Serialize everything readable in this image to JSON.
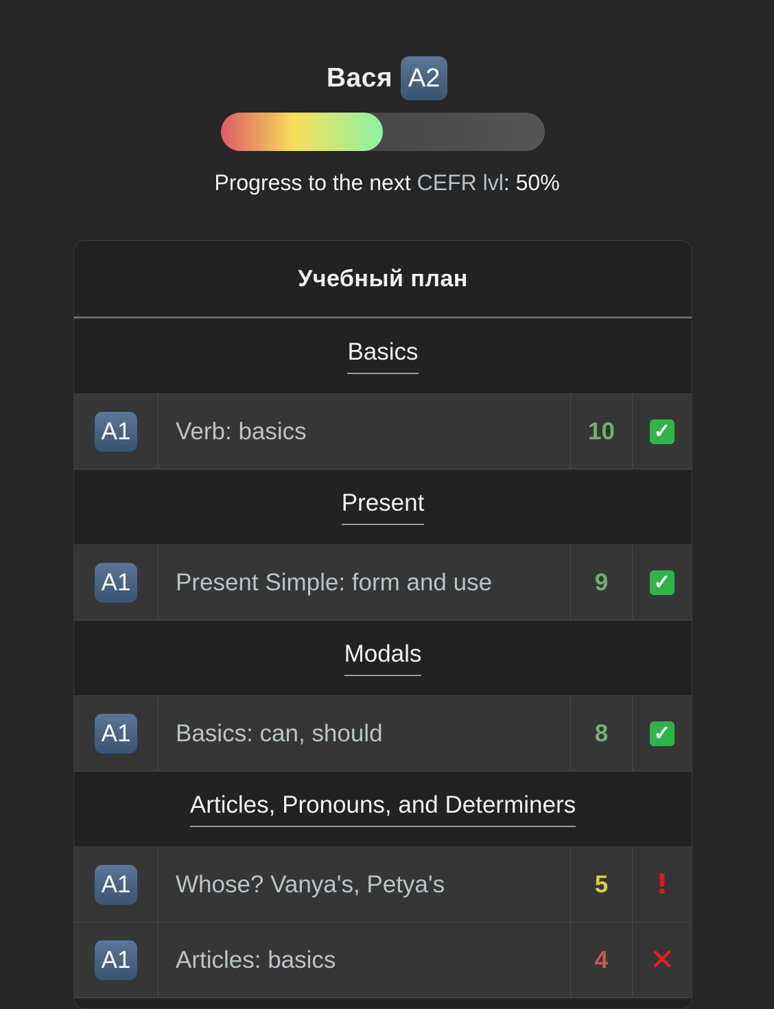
{
  "user": {
    "name": "Вася",
    "level": "A2"
  },
  "progress": {
    "value_percent": 50,
    "text_before": "Progress to the next ",
    "text_cefr": "CEFR lvl",
    "text_after": ": 50%"
  },
  "plan": {
    "title": "Учебный план",
    "sections": [
      {
        "name": "Basics",
        "topics": [
          {
            "level": "A1",
            "title": "Verb: basics",
            "score": "10",
            "score_color": "green",
            "status": "check"
          }
        ]
      },
      {
        "name": "Present",
        "topics": [
          {
            "level": "A1",
            "title": "Present Simple: form and use",
            "score": "9",
            "score_color": "green",
            "status": "check"
          }
        ]
      },
      {
        "name": "Modals",
        "topics": [
          {
            "level": "A1",
            "title": "Basics: can, should",
            "score": "8",
            "score_color": "green",
            "status": "check"
          }
        ]
      },
      {
        "name": "Articles, Pronouns, and Determiners",
        "topics": [
          {
            "level": "A1",
            "title": "Whose? Vanya's, Petya's",
            "score": "5",
            "score_color": "yellow",
            "status": "warning"
          },
          {
            "level": "A1",
            "title": "Articles: basics",
            "score": "4",
            "score_color": "red",
            "status": "cross"
          }
        ]
      }
    ]
  },
  "icons": {
    "check": "check-mark-icon",
    "warning": "exclamation-icon",
    "cross": "cross-mark-icon"
  }
}
